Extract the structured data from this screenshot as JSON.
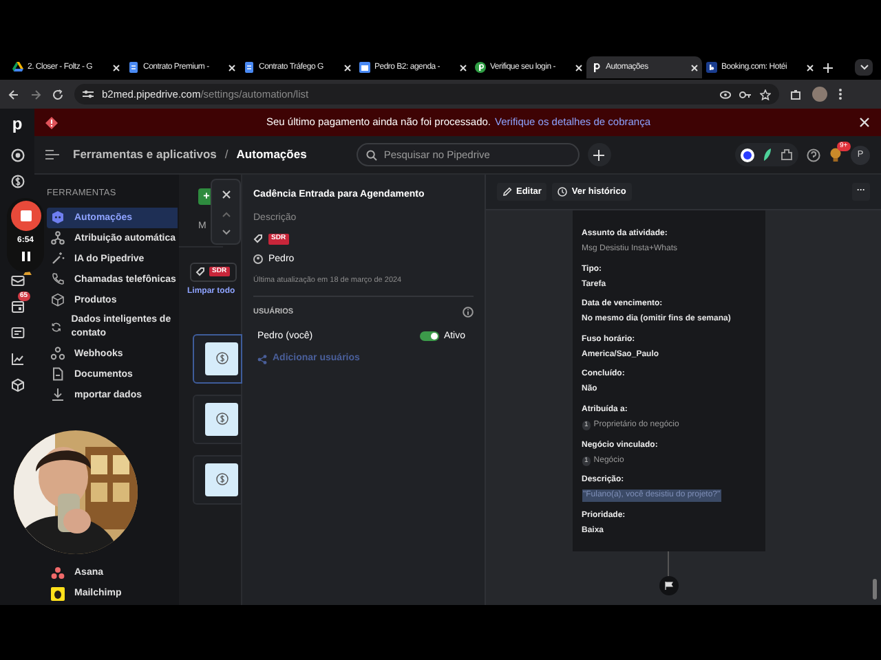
{
  "browser": {
    "tabs": [
      {
        "title": "2. Closer - Foltz - G",
        "kind": "drive",
        "selected": false
      },
      {
        "title": "Contrato Premium -",
        "kind": "docs",
        "selected": false
      },
      {
        "title": "Contrato Tráfego G",
        "kind": "docs",
        "selected": false
      },
      {
        "title": "Pedro B2: agenda -",
        "kind": "calendar",
        "selected": false
      },
      {
        "title": "Verifique seu login -",
        "kind": "green",
        "selected": false
      },
      {
        "title": "Automações",
        "kind": "pipedrive",
        "selected": true
      },
      {
        "title": "Booking.com: Hotéi",
        "kind": "booking",
        "selected": false
      }
    ],
    "url_domain": "b2med.pipedrive.com",
    "url_path": "/settings/automation/list"
  },
  "rail": {
    "logo": "p",
    "items": [
      {
        "kind": "target"
      },
      {
        "kind": "dollar"
      },
      {
        "kind": "mail",
        "warning": true
      },
      {
        "kind": "calendar",
        "badge": "65"
      },
      {
        "kind": "card"
      },
      {
        "kind": "chart"
      },
      {
        "kind": "box"
      }
    ]
  },
  "recorder": {
    "time": "6:54"
  },
  "banner": {
    "message": "Seu último pagamento ainda não foi processado.",
    "link": "Verifique os detalhes de cobrança"
  },
  "header": {
    "breadcrumb_parent": "Ferramentas e aplicativos",
    "separator": "/",
    "breadcrumb_current": "Automações",
    "search": {
      "placeholder": "Pesquisar no Pipedrive"
    },
    "notification_badge": "9+",
    "avatar": "P"
  },
  "sidebar": {
    "section": "FERRAMENTAS",
    "items": [
      {
        "label": "Automações",
        "kind": "robot",
        "selected": true
      },
      {
        "label": "Atribuição automática",
        "kind": "nodes",
        "selected": false
      },
      {
        "label": "IA do Pipedrive",
        "kind": "wand",
        "selected": false
      },
      {
        "label": "Chamadas telefônicas",
        "kind": "phone",
        "selected": false
      },
      {
        "label": "Produtos",
        "kind": "cube",
        "selected": false
      },
      {
        "label": "Dados inteligentes de contato",
        "kind": "sync",
        "selected": false
      },
      {
        "label": "Webhooks",
        "kind": "webhook",
        "selected": false
      },
      {
        "label": "Documentos",
        "kind": "doc",
        "selected": false
      },
      {
        "label": "mportar dados",
        "kind": "download",
        "selected": false
      }
    ],
    "bottom_items": [
      {
        "label": "Asana",
        "kind": "asana",
        "selected": false
      },
      {
        "label": "Mailchimp",
        "kind": "mailchimp",
        "selected": false
      }
    ]
  },
  "list_panel": {
    "add_button": "+",
    "column_label": "M",
    "tag": "SDR",
    "clear_link": "Limpar todo",
    "cards": [
      {
        "selected": true
      },
      {
        "selected": false
      },
      {
        "selected": false
      }
    ]
  },
  "detail": {
    "title": "Cadência Entrada para Agendamento",
    "description": "Descrição",
    "tag": "SDR",
    "owner": "Pedro",
    "updated": "Última atualização em 18 de março de 2024",
    "users_heading": "USUÁRIOS",
    "users": [
      {
        "name": "Pedro (você)",
        "on": true,
        "status": "Ativo"
      }
    ],
    "add_users": "Adicionar usuários"
  },
  "canvas": {
    "toolbar": {
      "edit": "Editar",
      "history": "Ver histórico",
      "more": "···"
    },
    "fields": [
      {
        "label": "Assunto da atividade:",
        "value": "Msg Desistiu Insta+Whats",
        "kind": "muted"
      },
      {
        "label": "Tipo:",
        "value": "Tarefa",
        "kind": "plain"
      },
      {
        "label": "Data de vencimento:",
        "value": "No mesmo dia (omitir fins de semana)",
        "kind": "plain"
      },
      {
        "label": "Fuso horário:",
        "value": "America/Sao_Paulo",
        "kind": "plain"
      },
      {
        "label": "Concluído:",
        "value": "Não",
        "kind": "plain"
      },
      {
        "label": "Atribuída a:",
        "count": "1",
        "value": "Proprietário do negócio",
        "kind": "counted"
      },
      {
        "label": "Negócio vinculado:",
        "count": "1",
        "value": "Negócio",
        "kind": "counted"
      },
      {
        "label": "Descrição:",
        "value": "\"Fulano(a), você desistiu do projeto?\"",
        "kind": "highlighted"
      },
      {
        "label": "Prioridade:",
        "value": "Baixa",
        "kind": "plain"
      }
    ]
  }
}
